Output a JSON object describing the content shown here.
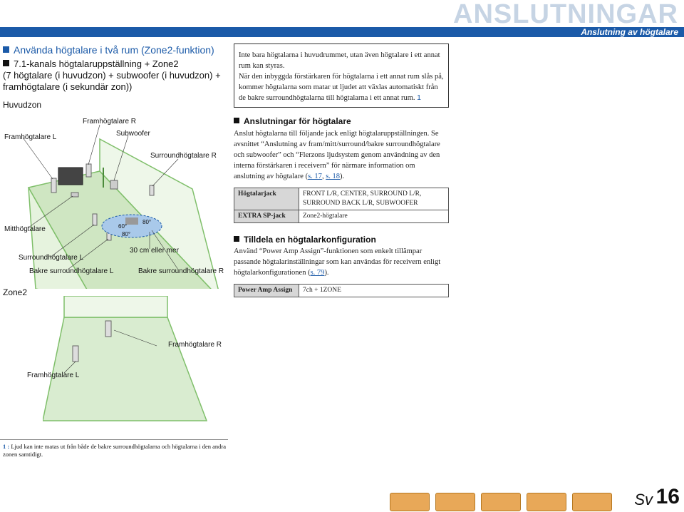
{
  "header": {
    "title": "ANSLUTNINGAR",
    "subtitle": "Anslutning av högtalare"
  },
  "section": {
    "title": "Använda högtalare i två rum (Zone2-funktion)",
    "setup_lines": [
      "7.1-kanals högtalaruppställning + Zone2",
      "(7 högtalare (i huvudzon) + subwoofer (i huvudzon) +",
      "framhögtalare (i sekundär zon))"
    ]
  },
  "diagram": {
    "main_zone": "Huvudzon",
    "zone2": "Zone2",
    "labels": {
      "front_l": "Framhögtalare L",
      "front_r": "Framhögtalare R",
      "subwoofer": "Subwoofer",
      "surround_r": "Surroundhögtalare R",
      "center": "Mitthögtalare",
      "surround_l": "Surroundhögtalare L",
      "back_l": "Bakre surroundhögtalare L",
      "back_r": "Bakre surroundhögtalare R",
      "distance": "30 cm eller mer",
      "deg60": "60°",
      "deg80": "80°",
      "z2_front_r": "Framhögtalare R",
      "z2_front_l": "Framhögtalare L"
    }
  },
  "note_box": {
    "line1": "Inte bara högtalarna i huvudrummet, utan även högtalare i ett annat rum kan styras.",
    "line2": "När den inbyggda förstärkaren för högtalarna i ett annat rum slås på, kommer högtalarna som matar ut ljudet att växlas automatiskt från de bakre surroundhögtalarna till högtalarna i ett annat rum.",
    "ref": "1"
  },
  "connections": {
    "title": "Anslutningar för högtalare",
    "intro": "Anslut högtalarna till följande jack enligt högtalaruppställningen. Se avsnittet “Anslutning av fram/mitt/surround/bakre surroundhögtalare och subwoofer” och “Flerzons ljudsystem genom användning av den interna förstärkaren i receivern” för närmare information om anslutning av högtalare (",
    "ref_a": "s. 17",
    "ref_sep": ", ",
    "ref_b": "s. 18",
    "end": ").",
    "table": [
      {
        "key": "Högtalarjack",
        "value": "FRONT L/R, CENTER, SURROUND L/R, SURROUND BACK L/R, SUBWOOFER"
      },
      {
        "key": "EXTRA SP-jack",
        "value": "Zone2-högtalare"
      }
    ]
  },
  "assign": {
    "title": "Tilldela en högtalarkonfiguration",
    "text": "Använd “Power Amp Assign”-funktionen som enkelt tillämpar passande högtalarinställningar som kan användas för receivern enligt högtalarkonfigurationen (",
    "ref": "s. 79",
    "end": ").",
    "table": [
      {
        "key": "Power Amp Assign",
        "value": "7ch + 1ZONE"
      }
    ]
  },
  "footnote": {
    "num": "1 :",
    "text": "Ljud kan inte matas ut från både de bakre surroundhögtalarna och högtalarna i den andra zonen samtidigt."
  },
  "footer": {
    "lang": "Sv",
    "page": "16"
  },
  "colors": {
    "accent": "#1b5aa8",
    "room_floor": "#cfe6c2",
    "room_line": "#7fbf6a",
    "nav_button": "#e8a858"
  }
}
